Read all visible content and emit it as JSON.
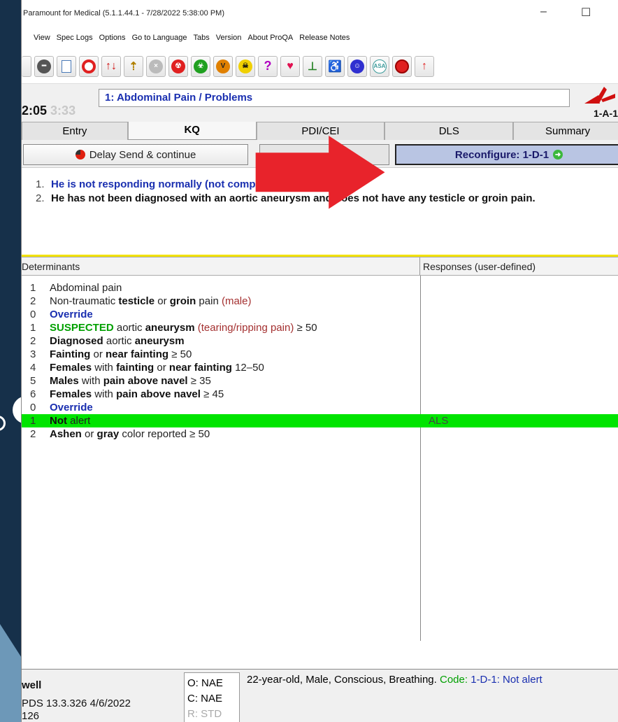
{
  "window": {
    "title": "Paramount for Medical (5.1.1.44.1 - 7/28/2022 5:38:00 PM)",
    "minimize": "–",
    "maximize": "☐"
  },
  "menu": [
    "View",
    "Spec Logs",
    "Options",
    "Go to Language",
    "Tabs",
    "Version",
    "About ProQA",
    "Release Notes"
  ],
  "toolbar_icons": [
    "minus-circle",
    "document",
    "target",
    "sort-arrows",
    "dispatch",
    "cancel",
    "radiation",
    "biohazard",
    "vehicle",
    "poison",
    "help",
    "heart",
    "aed",
    "choking",
    "support",
    "asa",
    "stop",
    "priority"
  ],
  "timer": {
    "elapsed": "2:05",
    "secondary": "3:33"
  },
  "chief_complaint": "1: Abdominal Pain / Problems",
  "determinant_code": "1-A-1",
  "tabs": [
    "Entry",
    "KQ",
    "PDI/CEI",
    "DLS",
    "Summary"
  ],
  "active_tab": "KQ",
  "buttons": {
    "delay_send": "Delay Send & continue",
    "reconfigure": "Reconfigure: 1-D-1"
  },
  "summary": [
    {
      "num": "1.",
      "text": "He is not responding normally (not completely alert)."
    },
    {
      "num": "2.",
      "text": "He has not been diagnosed with an aortic aneurysm and does not have any testicle or groin pain."
    }
  ],
  "grid": {
    "col1": "Determinants",
    "col2": "Responses (user-defined)"
  },
  "determinants": [
    {
      "n": "1",
      "parts": [
        [
          "Abdominal pain",
          "n"
        ]
      ]
    },
    {
      "n": "2",
      "parts": [
        [
          "Non-traumatic ",
          "n"
        ],
        [
          "testicle",
          "b"
        ],
        [
          " or ",
          "n"
        ],
        [
          "groin",
          "b"
        ],
        [
          " pain ",
          "n"
        ],
        [
          "(male)",
          "r"
        ]
      ]
    },
    {
      "n": "0",
      "parts": [
        [
          "Override",
          "bl"
        ]
      ]
    },
    {
      "n": "1",
      "parts": [
        [
          "SUSPECTED",
          "g"
        ],
        [
          " aortic ",
          "n"
        ],
        [
          "aneurysm",
          "b"
        ],
        [
          " (tearing/ripping pain)",
          "r"
        ],
        [
          " ≥ 50",
          "n"
        ]
      ]
    },
    {
      "n": "2",
      "parts": [
        [
          "Diagnosed",
          "b"
        ],
        [
          " aortic ",
          "n"
        ],
        [
          "aneurysm",
          "b"
        ]
      ]
    },
    {
      "n": "3",
      "parts": [
        [
          "Fainting",
          "b"
        ],
        [
          " or ",
          "n"
        ],
        [
          "near fainting",
          "b"
        ],
        [
          " ≥ 50",
          "n"
        ]
      ]
    },
    {
      "n": "4",
      "parts": [
        [
          "Females",
          "b"
        ],
        [
          " with ",
          "n"
        ],
        [
          "fainting",
          "b"
        ],
        [
          " or ",
          "n"
        ],
        [
          "near fainting",
          "b"
        ],
        [
          " 12–50",
          "n"
        ]
      ]
    },
    {
      "n": "5",
      "parts": [
        [
          "Males",
          "b"
        ],
        [
          " with ",
          "n"
        ],
        [
          "pain above navel",
          "b"
        ],
        [
          " ≥ 35",
          "n"
        ]
      ]
    },
    {
      "n": "6",
      "parts": [
        [
          "Females",
          "b"
        ],
        [
          " with ",
          "n"
        ],
        [
          "pain above navel",
          "b"
        ],
        [
          " ≥ 45",
          "n"
        ]
      ]
    },
    {
      "n": "0",
      "parts": [
        [
          "Override",
          "bl"
        ]
      ]
    },
    {
      "n": "1",
      "parts": [
        [
          "Not",
          "b"
        ],
        [
          " alert",
          "n"
        ]
      ],
      "highlight": true,
      "response": "ALS"
    },
    {
      "n": "2",
      "parts": [
        [
          "Ashen",
          "b"
        ],
        [
          " or ",
          "n"
        ],
        [
          "gray",
          "b"
        ],
        [
          " color reported ≥ 50",
          "n"
        ]
      ]
    }
  ],
  "status": {
    "user": "well",
    "version": "PDS  13.3.326  4/6/2022",
    "extra": "126",
    "o": "O: NAE",
    "c": "C: NAE",
    "r": "R: STD",
    "text": "22-year-old, Male, Conscious, Breathing. ",
    "code_label": "Code: ",
    "code": "1-D-1",
    "code_desc": ": Not alert"
  },
  "colors": {
    "highlight": "#00e400",
    "divider": "#f2e200",
    "arrow": "#e8232b",
    "reconfigure_bg": "#b9c5e3"
  }
}
